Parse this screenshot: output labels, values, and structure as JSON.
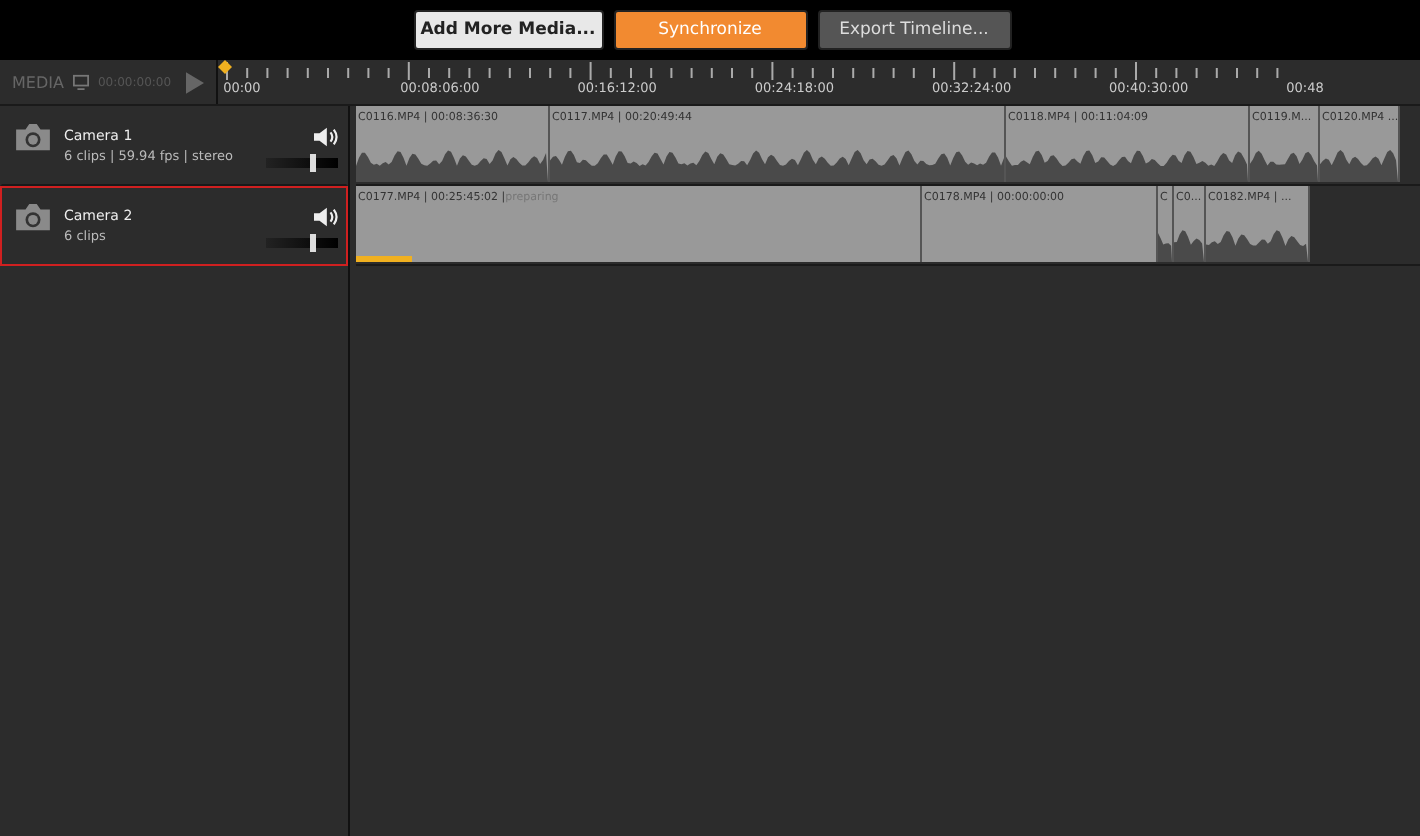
{
  "toolbar": {
    "buttons": [
      {
        "label": "Add More Media...",
        "kind": "light"
      },
      {
        "label": "Synchronize",
        "kind": "primary"
      },
      {
        "label": "Export Timeline...",
        "kind": "dark"
      }
    ]
  },
  "media_header": {
    "title": "MEDIA",
    "timecode": "00:00:00:00"
  },
  "ruler": {
    "labels": [
      "00:00",
      "00:08:06:00",
      "00:16:12:00",
      "00:24:18:00",
      "00:32:24:00",
      "00:40:30:00",
      "00:48"
    ]
  },
  "tracks": [
    {
      "name": "Camera 1",
      "info": "6 clips  |  59.94 fps  |  stereo",
      "selected": false,
      "volume": {
        "level": 0.6
      },
      "clips": [
        {
          "label": "C0116.MP4 | 00:08:36:30",
          "waveform": true
        },
        {
          "label": "C0117.MP4 | 00:20:49:44",
          "waveform": true
        },
        {
          "label": "C0118.MP4 | 00:11:04:09",
          "waveform": true
        },
        {
          "label": "C0119.M...",
          "waveform": true
        },
        {
          "label": "C0120.MP4 ...",
          "waveform": true
        }
      ]
    },
    {
      "name": "Camera 2",
      "info": "6 clips",
      "selected": true,
      "volume": {
        "level": 0.6
      },
      "clips": [
        {
          "label": "C0177.MP4 | 00:25:45:02 |",
          "status": "preparing",
          "progress": {
            "level": 0.1
          },
          "waveform": false
        },
        {
          "label": "C0178.MP4 | 00:00:00:00",
          "waveform": false
        },
        {
          "label": "C",
          "waveform": true
        },
        {
          "label": "C0...",
          "waveform": true
        },
        {
          "label": "C0182.MP4 | ...",
          "waveform": true
        }
      ]
    }
  ]
}
